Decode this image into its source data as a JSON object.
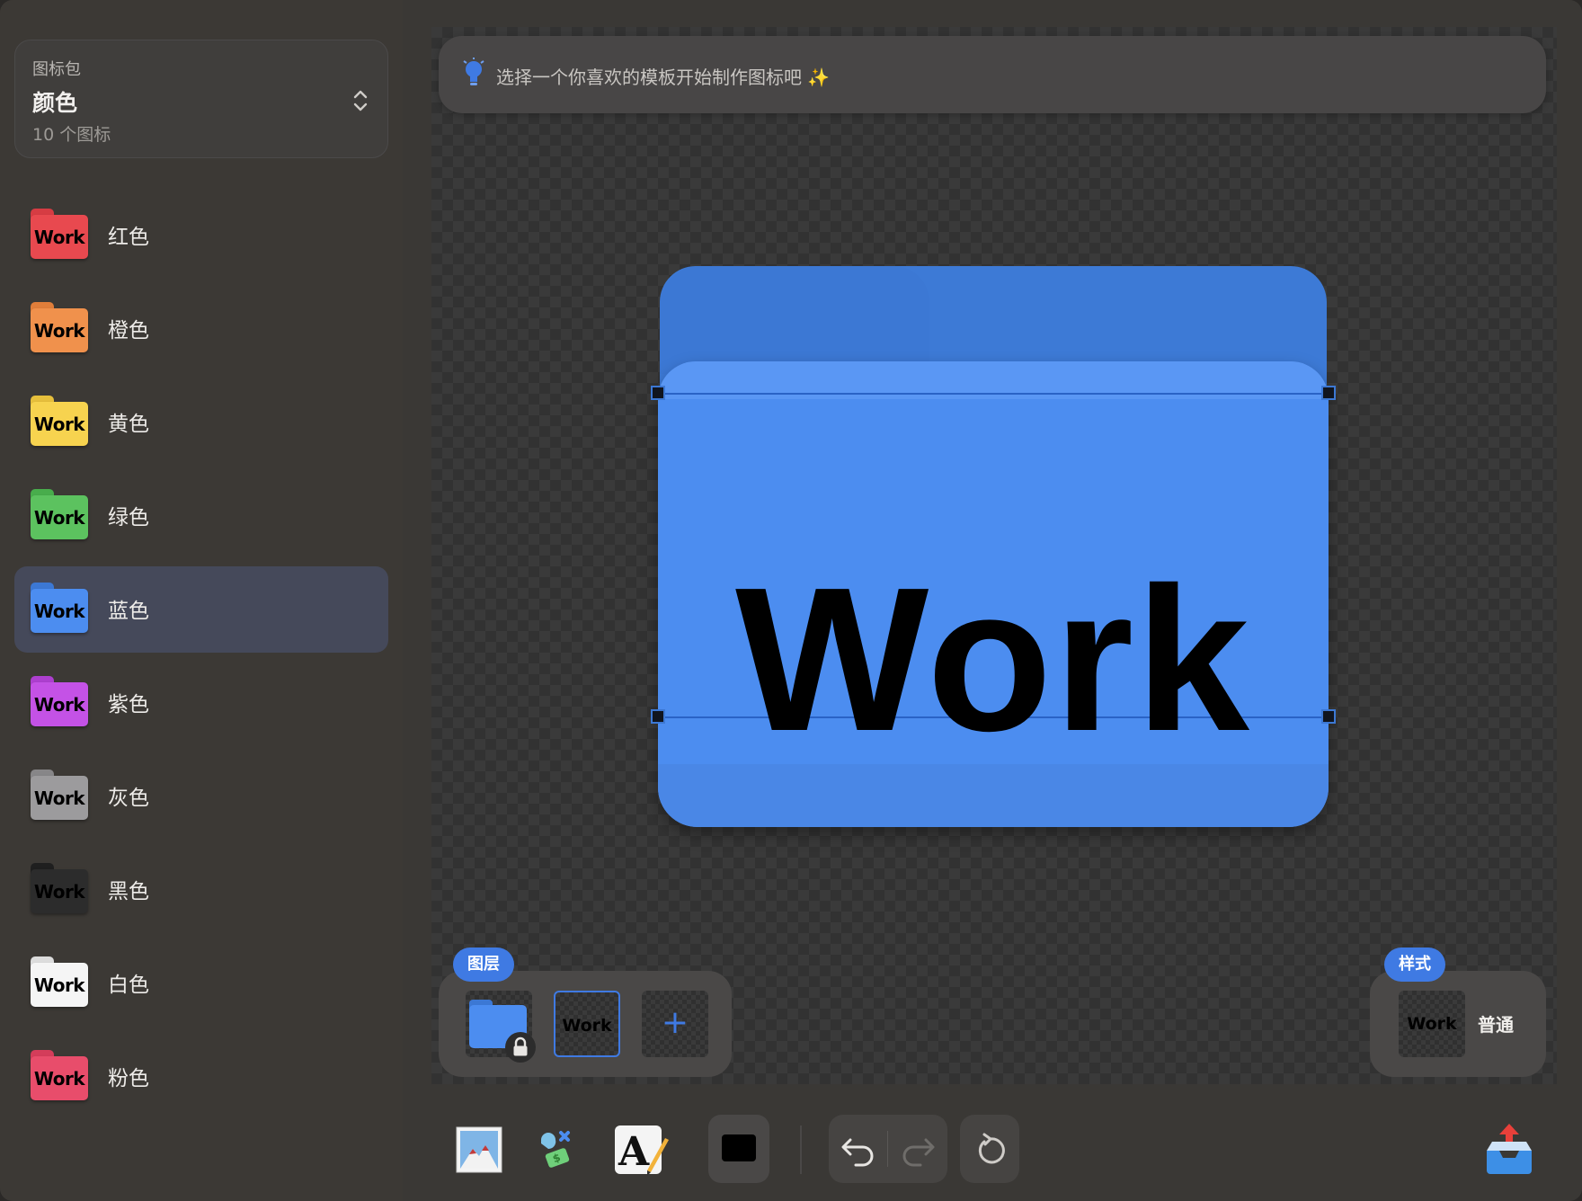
{
  "sidebar": {
    "pack": {
      "caption": "图标包",
      "name": "颜色",
      "count": "10 个图标"
    },
    "items": [
      {
        "label": "红色",
        "thumb_text": "Work",
        "color": "#e8494f",
        "tab_color": "#d63c43",
        "selected": false
      },
      {
        "label": "橙色",
        "thumb_text": "Work",
        "color": "#f0914c",
        "tab_color": "#e07e3a",
        "selected": false
      },
      {
        "label": "黄色",
        "thumb_text": "Work",
        "color": "#f7d34f",
        "tab_color": "#e6bf3c",
        "selected": false
      },
      {
        "label": "绿色",
        "thumb_text": "Work",
        "color": "#5cc25f",
        "tab_color": "#48ad4c",
        "selected": false
      },
      {
        "label": "蓝色",
        "thumb_text": "Work",
        "color": "#4c8df0",
        "tab_color": "#3c78d4",
        "selected": true
      },
      {
        "label": "紫色",
        "thumb_text": "Work",
        "color": "#c452e6",
        "tab_color": "#ad3fcf",
        "selected": false
      },
      {
        "label": "灰色",
        "thumb_text": "Work",
        "color": "#9c9b9d",
        "tab_color": "#878688",
        "selected": false
      },
      {
        "label": "黑色",
        "thumb_text": "Work",
        "color": "#2c2c2c",
        "tab_color": "#1f1f1f",
        "selected": false
      },
      {
        "label": "白色",
        "thumb_text": "Work",
        "color": "#f5f5f5",
        "tab_color": "#dcdcdc",
        "selected": false
      },
      {
        "label": "粉色",
        "thumb_text": "Work",
        "color": "#e84d6b",
        "tab_color": "#d43d5a",
        "selected": false
      }
    ]
  },
  "hint": {
    "text": "选择一个你喜欢的模板开始制作图标吧 ✨"
  },
  "canvas": {
    "label": "Work",
    "folder_color": "#4c8df0",
    "accent": "#3f7ae3"
  },
  "layers": {
    "title": "图层",
    "text_layer": "Work",
    "add_label": "+"
  },
  "style": {
    "title": "样式",
    "thumb_text": "Work",
    "name": "普通"
  }
}
